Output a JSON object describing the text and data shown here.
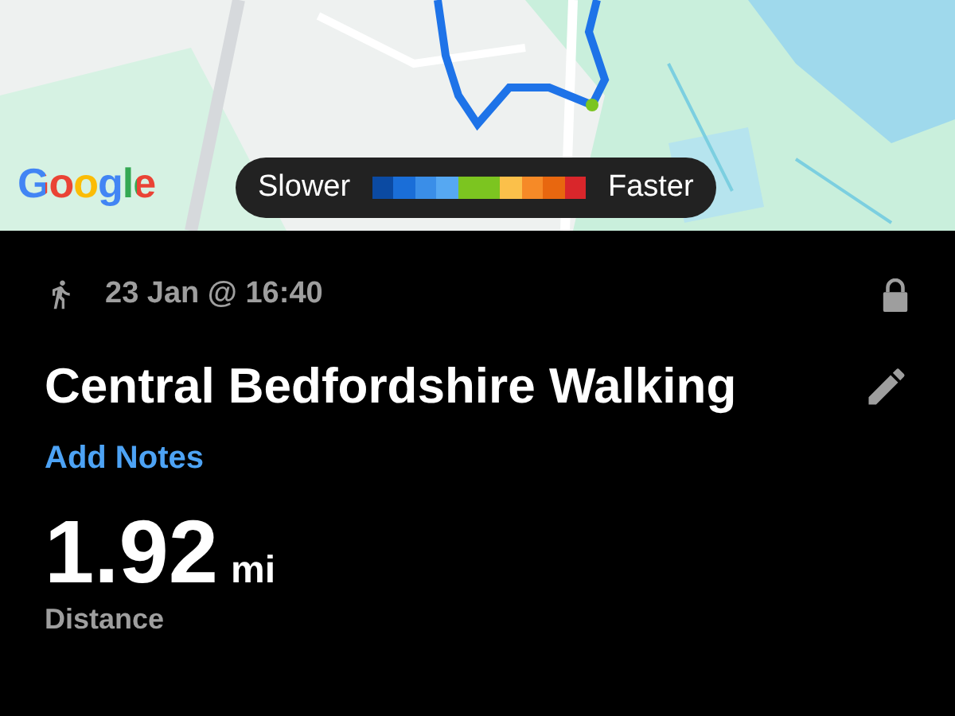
{
  "map": {
    "attribution": "Google",
    "legend": {
      "low_label": "Slower",
      "high_label": "Faster",
      "swatches": [
        {
          "color": "#0b4aa2"
        },
        {
          "color": "#1a6ed8"
        },
        {
          "color": "#3a8ee8"
        },
        {
          "color": "#56a8f2"
        },
        {
          "color": "#7cc520"
        },
        {
          "color": "#7cc520"
        },
        {
          "color": "#fbc04a"
        },
        {
          "color": "#f68a27"
        },
        {
          "color": "#e8670f"
        },
        {
          "color": "#d9262b"
        }
      ]
    }
  },
  "activity": {
    "date": "23 Jan @ 16:40",
    "locked": true,
    "title": "Central Bedfordshire Walking",
    "notes_link": "Add Notes"
  },
  "stats": [
    {
      "value": "1.92",
      "unit": "mi",
      "label": "Distance"
    }
  ]
}
